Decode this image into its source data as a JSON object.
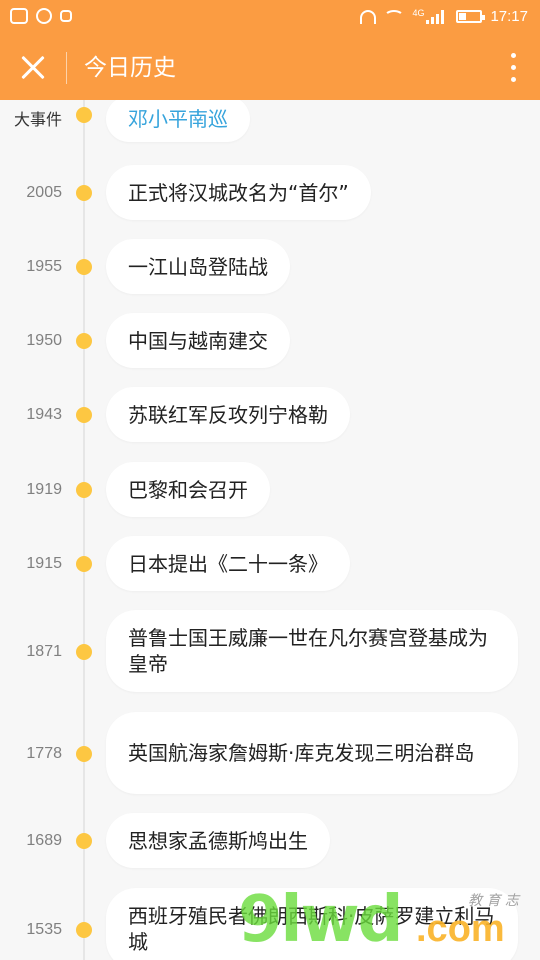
{
  "status_bar": {
    "time": "17:17",
    "network": "4G",
    "left_icons": [
      "app-icon",
      "swirl-icon",
      "alipay-icon"
    ],
    "right_icons": [
      "headset-icon",
      "wifi-icon",
      "signal-icon",
      "battery-icon"
    ]
  },
  "app_bar": {
    "title": "今日历史",
    "close_icon": "close-icon",
    "more_icon": "more-vertical-icon",
    "background": "#fb9c42"
  },
  "timeline": {
    "dot_color": "#fdc742",
    "highlight_color": "#37a4dc",
    "items": [
      {
        "year": "大事件",
        "event": "邓小平南巡"
      },
      {
        "year": "2005",
        "event": "正式将汉城改名为“首尔”"
      },
      {
        "year": "1955",
        "event": "一江山岛登陆战"
      },
      {
        "year": "1950",
        "event": "中国与越南建交"
      },
      {
        "year": "1943",
        "event": "苏联红军反攻列宁格勒"
      },
      {
        "year": "1919",
        "event": "巴黎和会召开"
      },
      {
        "year": "1915",
        "event": "日本提出《二十一条》"
      },
      {
        "year": "1871",
        "event": "普鲁士国王威廉一世在凡尔赛宫登基成为皇帝"
      },
      {
        "year": "1778",
        "event": "英国航海家詹姆斯·库克发现三明治群岛"
      },
      {
        "year": "1689",
        "event": "思想家孟德斯鸠出生"
      },
      {
        "year": "1535",
        "event": "西班牙殖民者佛朗西斯科·皮萨罗建立利马城"
      }
    ]
  },
  "watermark": {
    "text_main": "9lwd",
    "text_suffix": ".com",
    "text_tag": "教 育 志"
  }
}
